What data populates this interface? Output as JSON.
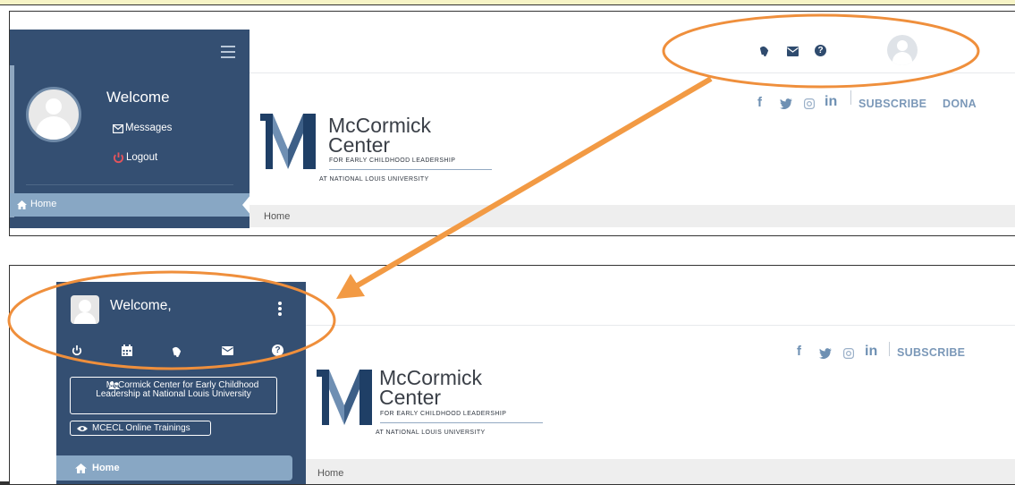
{
  "colors": {
    "sidebar": "#344f72",
    "sidebar_active": "#88a7c4",
    "accent_orange": "#ef8f3c",
    "logout_red": "#e4545c",
    "social_blue": "#6e90b3"
  },
  "top_panel": {
    "welcome": "Welcome",
    "messages_label": "Messages",
    "logout_label": "Logout",
    "home_nav": "Home",
    "header_icons": [
      "bell-icon",
      "envelope-icon",
      "question-icon",
      "avatar-icon"
    ],
    "social": {
      "facebook": "f",
      "twitter": "twitter-icon",
      "instagram": "instagram-icon",
      "linkedin": "in",
      "subscribe": "SUBSCRIBE",
      "donate": "DONA"
    },
    "logo": {
      "line1": "McCormick",
      "line2": "Center",
      "tagline": "FOR EARLY CHILDHOOD LEADERSHIP",
      "sub": "AT NATIONAL LOUIS UNIVERSITY"
    },
    "breadcrumb": "Home"
  },
  "bottom_panel": {
    "welcome": "Welcome,",
    "action_icons": [
      "power-icon",
      "calendar-icon",
      "bell-icon",
      "envelope-icon",
      "question-icon"
    ],
    "org_button": "McCormick Center for Early Childhood Leadership at National Louis University",
    "trainings_button": "MCECL Online Trainings",
    "home_nav": "Home",
    "social": {
      "facebook": "f",
      "linkedin": "in",
      "subscribe": "SUBSCRIBE"
    },
    "logo": {
      "line1": "McCormick",
      "line2": "Center",
      "tagline": "FOR EARLY CHILDHOOD LEADERSHIP",
      "sub": "AT NATIONAL LOUIS UNIVERSITY"
    },
    "breadcrumb": "Home"
  }
}
